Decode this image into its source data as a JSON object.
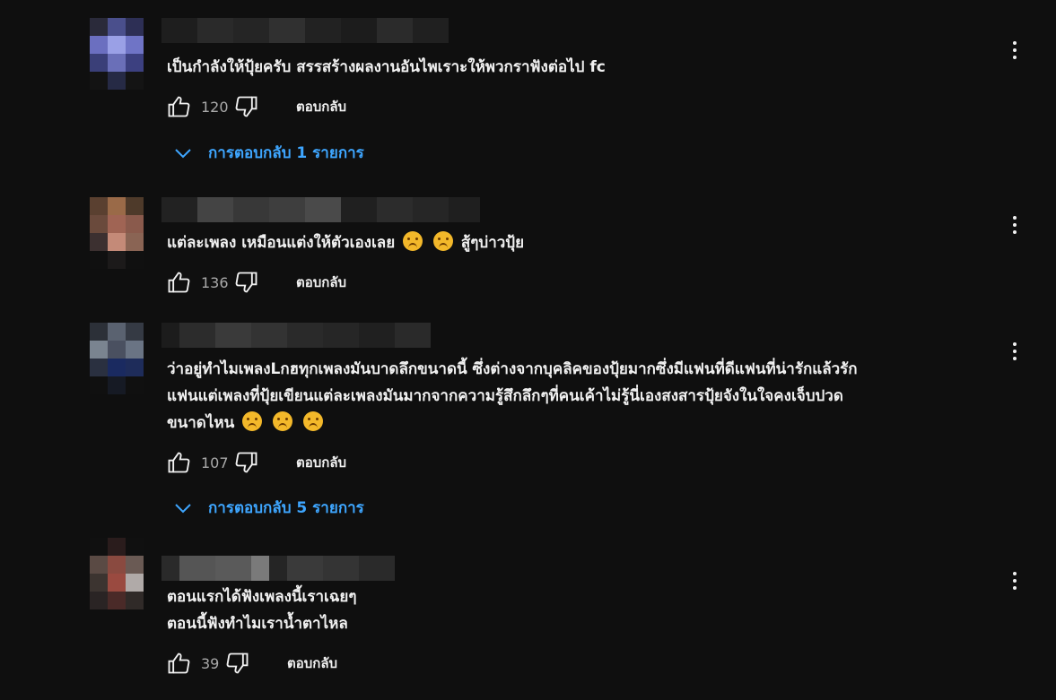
{
  "colors": {
    "background": "#0f0f0f",
    "text": "#f1f1f1",
    "muted": "#aaaaaa",
    "link": "#3ea6ff"
  },
  "reply_label": "ตอบกลับ",
  "comments": [
    {
      "avatar": "pixelated-avatar",
      "lines": [
        "เป็นกำลังให้ปุ้ยครับ สรรสร้างผลงานอันไพเราะให้พวกราฟังต่อไป fc"
      ],
      "likes": "120",
      "replies_label": "การตอบกลับ 1 รายการ"
    },
    {
      "avatar": "pixelated-avatar",
      "lines": [
        "แต่ละเพลง เหมือนแต่งให้ตัวเองเลย",
        "สู้ๆบ่าวปุ้ย"
      ],
      "likes": "136"
    },
    {
      "avatar": "pixelated-avatar",
      "lines": [
        "ว่าอยู่ทำไมเพลงLกฮทุกเพลงมันบาดลึกขนาดนี้ ซึ่งต่างจากบุคลิคของปุ้ยมากซึ่งมีแฟนที่ดีแฟนที่น่ารักแล้วรัก",
        "แฟนแต่เพลงที่ปุ้ยเขียนแต่ละเพลงมันมากจากความรู้สึกลึกๆที่คนเค้าไม่รู้นี่เองสงสารปุ้ยจังในใจคงเจ็บปวด",
        "ขนาดไหน"
      ],
      "likes": "107",
      "replies_label": "การตอบกลับ 5 รายการ"
    },
    {
      "avatar": "pixelated-avatar",
      "lines": [
        "ตอนแรกได้ฟังเพลงนี้เราเฉยๆ",
        "ตอนนี้ฟังทำไมเราน้ำตาไหล"
      ],
      "likes": "39"
    }
  ]
}
